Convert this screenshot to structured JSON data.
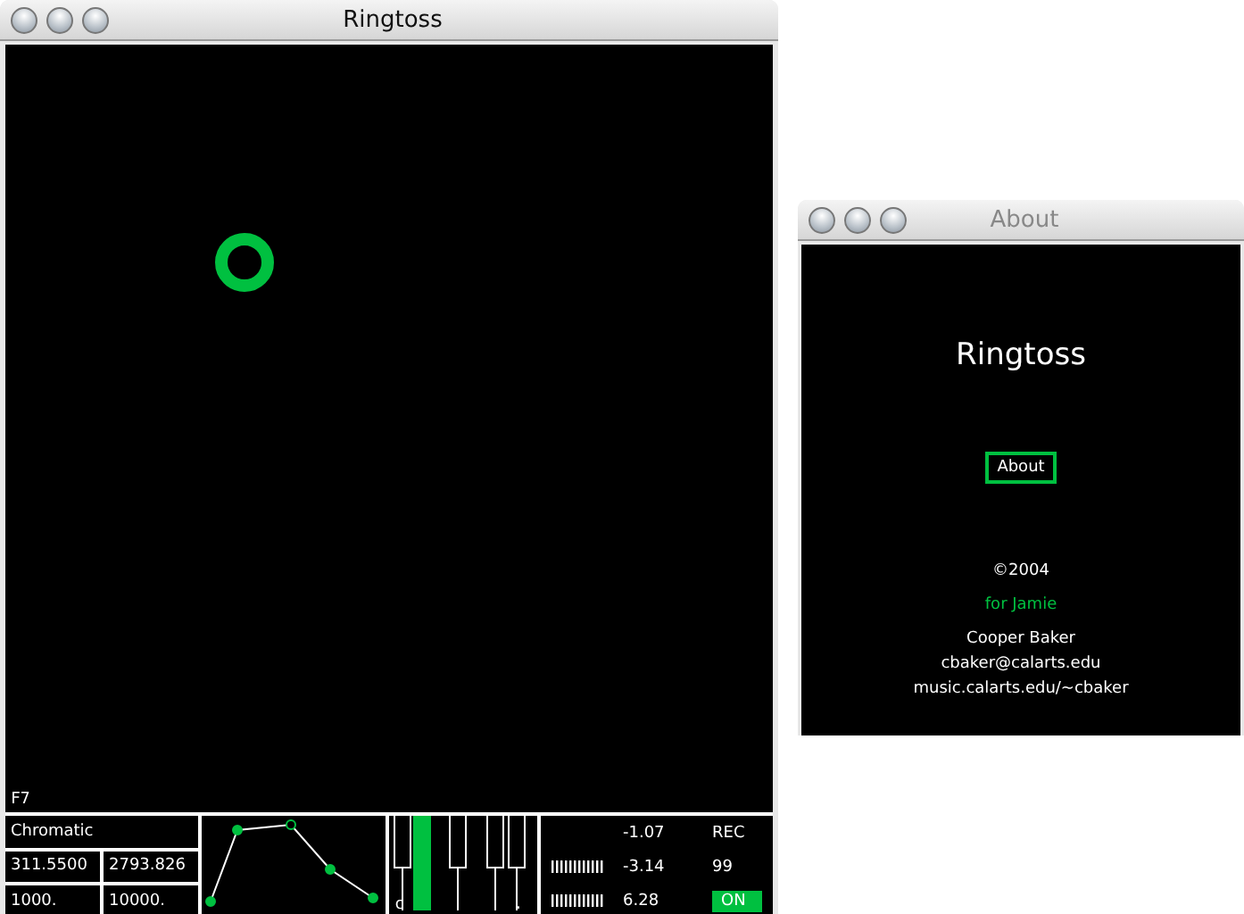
{
  "main_window": {
    "title": "Ringtoss",
    "canvas_label": "F7"
  },
  "controls": {
    "scale": "Chromatic",
    "values": [
      "311.5500",
      "2793.826",
      "1000.",
      "10000."
    ],
    "keyboard": {
      "keys": [
        {
          "selected": false
        },
        {
          "selected": true
        },
        {
          "selected": false
        },
        {
          "selected": false
        },
        {
          "selected": false
        }
      ],
      "low_label": "c",
      "high_label": "."
    },
    "readouts": [
      "-1.07",
      "-3.14",
      "6.28"
    ],
    "rec_label": "REC",
    "count": "99",
    "toggle": {
      "label": "ON",
      "on": true
    }
  },
  "about_window": {
    "title": "About",
    "app_name": "Ringtoss",
    "button": "About",
    "copyright": "©2004",
    "dedication": "for Jamie",
    "author": "Cooper Baker",
    "email": "cbaker@calarts.edu",
    "website": "music.calarts.edu/~cbaker"
  }
}
